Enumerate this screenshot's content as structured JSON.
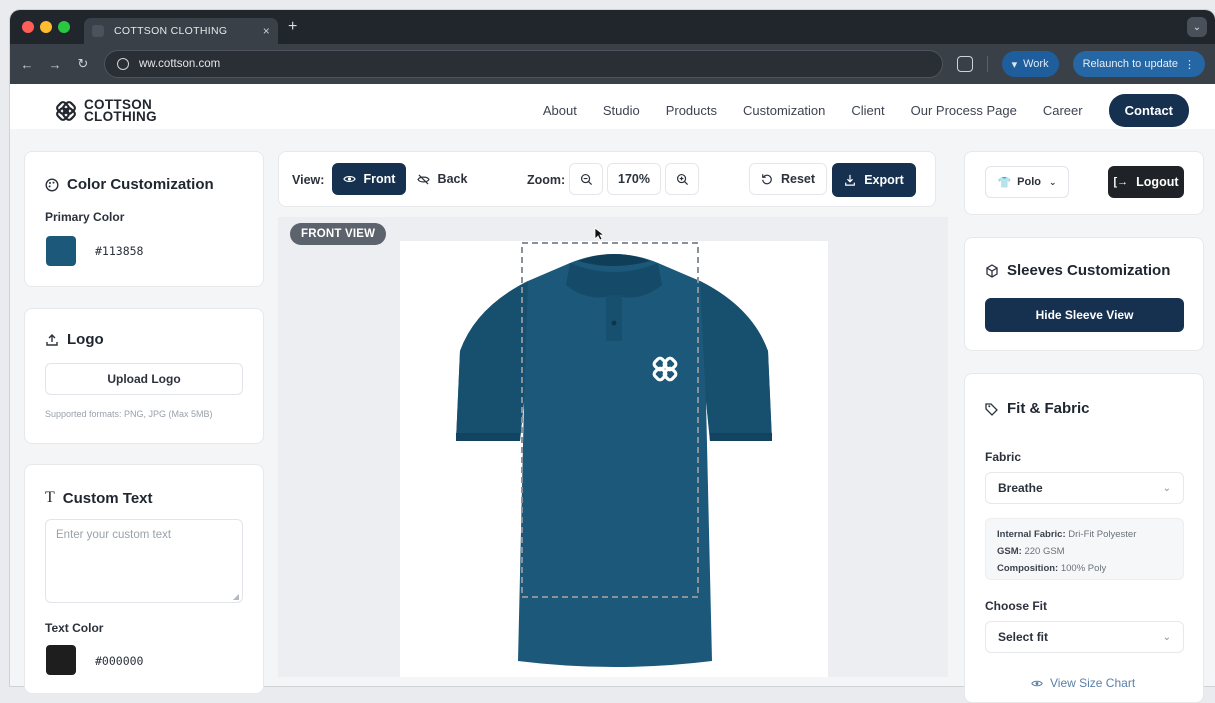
{
  "browser": {
    "tab_title": "COTTSON CLOTHING",
    "tab_close": "×",
    "new_tab": "+",
    "url": "ww.cottson.com",
    "profile_label": "Work",
    "relaunch_label": "Relaunch to update"
  },
  "site": {
    "brand_line1": "COTTSON",
    "brand_line2": "CLOTHING",
    "nav": [
      "About",
      "Studio",
      "Products",
      "Customization",
      "Client",
      "Our Process Page",
      "Career"
    ],
    "contact_label": "Contact"
  },
  "color_card": {
    "title": "Color Customization",
    "primary_label": "Primary Color",
    "primary_hex": "#113858",
    "primary_color": "#1b587a"
  },
  "logo_card": {
    "title": "Logo",
    "upload_label": "Upload Logo",
    "formats_note": "Supported formats: PNG, JPG (Max 5MB)"
  },
  "text_card": {
    "title": "Custom Text",
    "placeholder": "Enter your custom text",
    "text_color_label": "Text Color",
    "text_color_hex": "#000000",
    "text_color": "#1e1e1e"
  },
  "toolbar": {
    "view_label": "View:",
    "front_label": "Front",
    "back_label": "Back",
    "zoom_label": "Zoom:",
    "zoom_value": "170%",
    "reset_label": "Reset",
    "export_label": "Export"
  },
  "canvas": {
    "badge": "FRONT VIEW",
    "shirt_color": "#1b587a"
  },
  "right_panel": {
    "product_label": "Polo",
    "logout_label": "Logout",
    "sleeves_title": "Sleeves Customization",
    "hide_sleeve_label": "Hide Sleeve View",
    "fit_title": "Fit & Fabric",
    "fabric_label": "Fabric",
    "fabric_value": "Breathe",
    "internal_fabric_key": "Internal Fabric:",
    "internal_fabric_value": "Dri-Fit Polyester",
    "gsm_key": "GSM:",
    "gsm_value": "220 GSM",
    "composition_key": "Composition:",
    "composition_value": "100% Poly",
    "choose_fit_label": "Choose Fit",
    "fit_value": "Select fit",
    "size_chart_label": "View Size Chart"
  },
  "colors": {
    "brand_dark": "#16304f",
    "accent": "#1b587a"
  }
}
